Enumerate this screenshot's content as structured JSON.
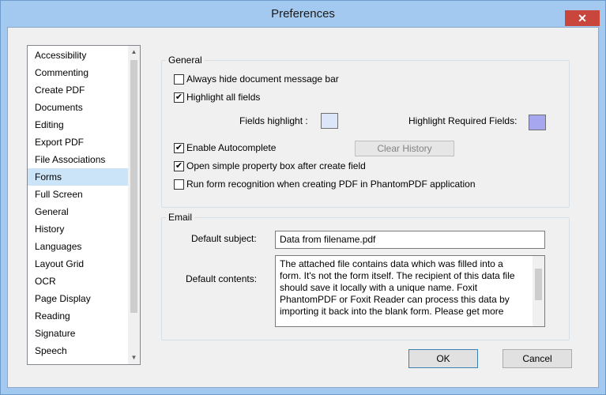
{
  "window": {
    "title": "Preferences",
    "close_glyph": "✕"
  },
  "sidebar": {
    "items": [
      {
        "label": "Accessibility"
      },
      {
        "label": "Commenting"
      },
      {
        "label": "Create PDF"
      },
      {
        "label": "Documents"
      },
      {
        "label": "Editing"
      },
      {
        "label": "Export PDF"
      },
      {
        "label": "File Associations"
      },
      {
        "label": "Forms",
        "selected": true
      },
      {
        "label": "Full Screen"
      },
      {
        "label": "General"
      },
      {
        "label": "History"
      },
      {
        "label": "Languages"
      },
      {
        "label": "Layout Grid"
      },
      {
        "label": "OCR"
      },
      {
        "label": "Page Display"
      },
      {
        "label": "Reading"
      },
      {
        "label": "Signature"
      },
      {
        "label": "Speech"
      }
    ],
    "scroll_up_glyph": "▲",
    "scroll_down_glyph": "▼"
  },
  "general": {
    "legend": "General",
    "always_hide": {
      "label": "Always hide document message bar",
      "checked": false
    },
    "highlight_all": {
      "label": "Highlight all fields",
      "checked": true
    },
    "fields_highlight_label": "Fields highlight :",
    "fields_highlight_color": "#dce6f8",
    "required_highlight_label": "Highlight Required Fields:",
    "required_highlight_color": "#a7a7ef",
    "enable_autocomplete": {
      "label": "Enable Autocomplete",
      "checked": true
    },
    "clear_history": "Clear History",
    "open_property_box": {
      "label": "Open simple property box after create field",
      "checked": true
    },
    "run_recognition": {
      "label": "Run form recognition when creating PDF in PhantomPDF application",
      "checked": false
    },
    "check_glyph": "✔"
  },
  "email": {
    "legend": "Email",
    "subject_label": "Default subject:",
    "subject_value": "Data from filename.pdf",
    "contents_label": "Default contents:",
    "contents_lines": [
      "The attached file contains data which was filled into a",
      "form. It's not the form itself. The recipient of this data file",
      "should save it locally with a unique name. Foxit",
      "PhantomPDF or Foxit Reader can process this data by",
      "importing it back into the blank form. Please get more"
    ]
  },
  "buttons": {
    "ok": "OK",
    "cancel": "Cancel"
  }
}
